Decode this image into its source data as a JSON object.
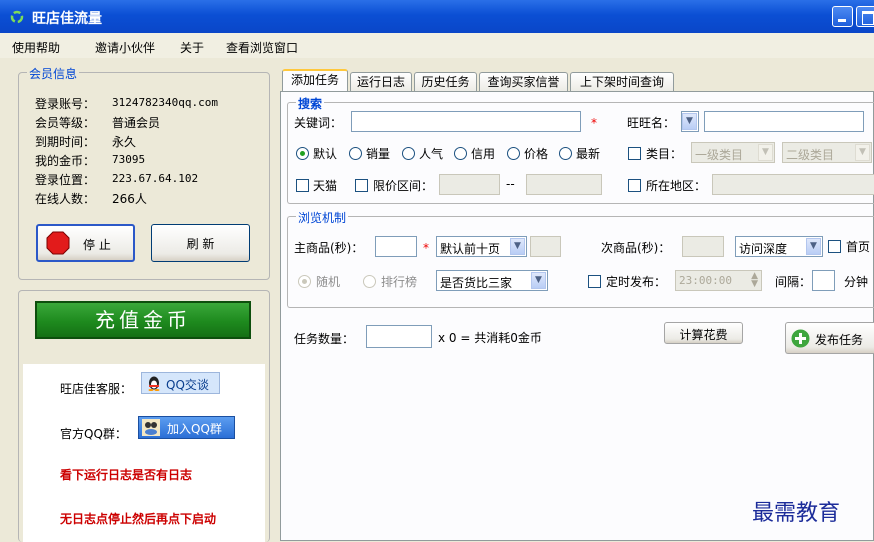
{
  "window": {
    "title": "旺店佳流量"
  },
  "menu": [
    "使用帮助",
    "邀请小伙伴",
    "关于",
    "查看浏览窗口"
  ],
  "member": {
    "group_title": "会员信息",
    "rows": [
      {
        "label": "登录账号：",
        "value": "3124782340qq.com"
      },
      {
        "label": "会员等级：",
        "value": "普通会员"
      },
      {
        "label": "到期时间：",
        "value": "永久"
      },
      {
        "label": "我的金币：",
        "value": "73095"
      },
      {
        "label": "登录位置：",
        "value": "223.67.64.102"
      },
      {
        "label": "在线人数：",
        "value": "266人"
      }
    ],
    "stop_label": "停 止",
    "refresh_label": "刷 新"
  },
  "recharge": {
    "label": "充值金币"
  },
  "support": {
    "service_label": "旺店佳客服：",
    "qq_talk_label": "QQ交谈",
    "group_label": "官方QQ群：",
    "join_group_label": "加入QQ群",
    "tip1": "看下运行日志是否有日志",
    "tip2": "无日志点停止然后再点下启动"
  },
  "tabs": [
    "添加任务",
    "运行日志",
    "历史任务",
    "查询买家信誉",
    "上下架时间查询"
  ],
  "search": {
    "group_title": "搜索",
    "keyword_label": "关键词：",
    "keyword_value": "",
    "wangwang_label": "旺旺名：",
    "star": "*",
    "sort_options": [
      "默认",
      "销量",
      "人气",
      "信用",
      "价格",
      "最新"
    ],
    "sort_selected": 0,
    "category_label": "类目：",
    "category1": "一级类目",
    "category2": "二级类目",
    "tmall_label": "天猫",
    "price_label": "限价区间：",
    "price_sep": "--",
    "region_label": "所在地区："
  },
  "browse": {
    "group_title": "浏览机制",
    "main_label": "主商品(秒)：",
    "main_select": "默认前十页",
    "secondary_label": "次商品(秒)：",
    "depth_select": "访问深度",
    "homepage_label": "首页",
    "random_label": "随机",
    "rank_label": "排行榜",
    "compare_select": "是否货比三家",
    "timed_label": "定时发布：",
    "timed_value": "23:00:00",
    "interval_label": "间隔：",
    "minute_label": "分钟"
  },
  "task": {
    "count_label": "任务数量：",
    "cost_text": "x 0 = 共消耗0金币",
    "calc_label": "计算花费",
    "publish_label": "发布任务"
  },
  "watermark": "最需教育",
  "colors": {
    "title_bar": "#0b4fd4",
    "recharge_green": "#1e8a1e",
    "tip_red": "#cc0000",
    "group_title_blue": "#0046d5"
  }
}
